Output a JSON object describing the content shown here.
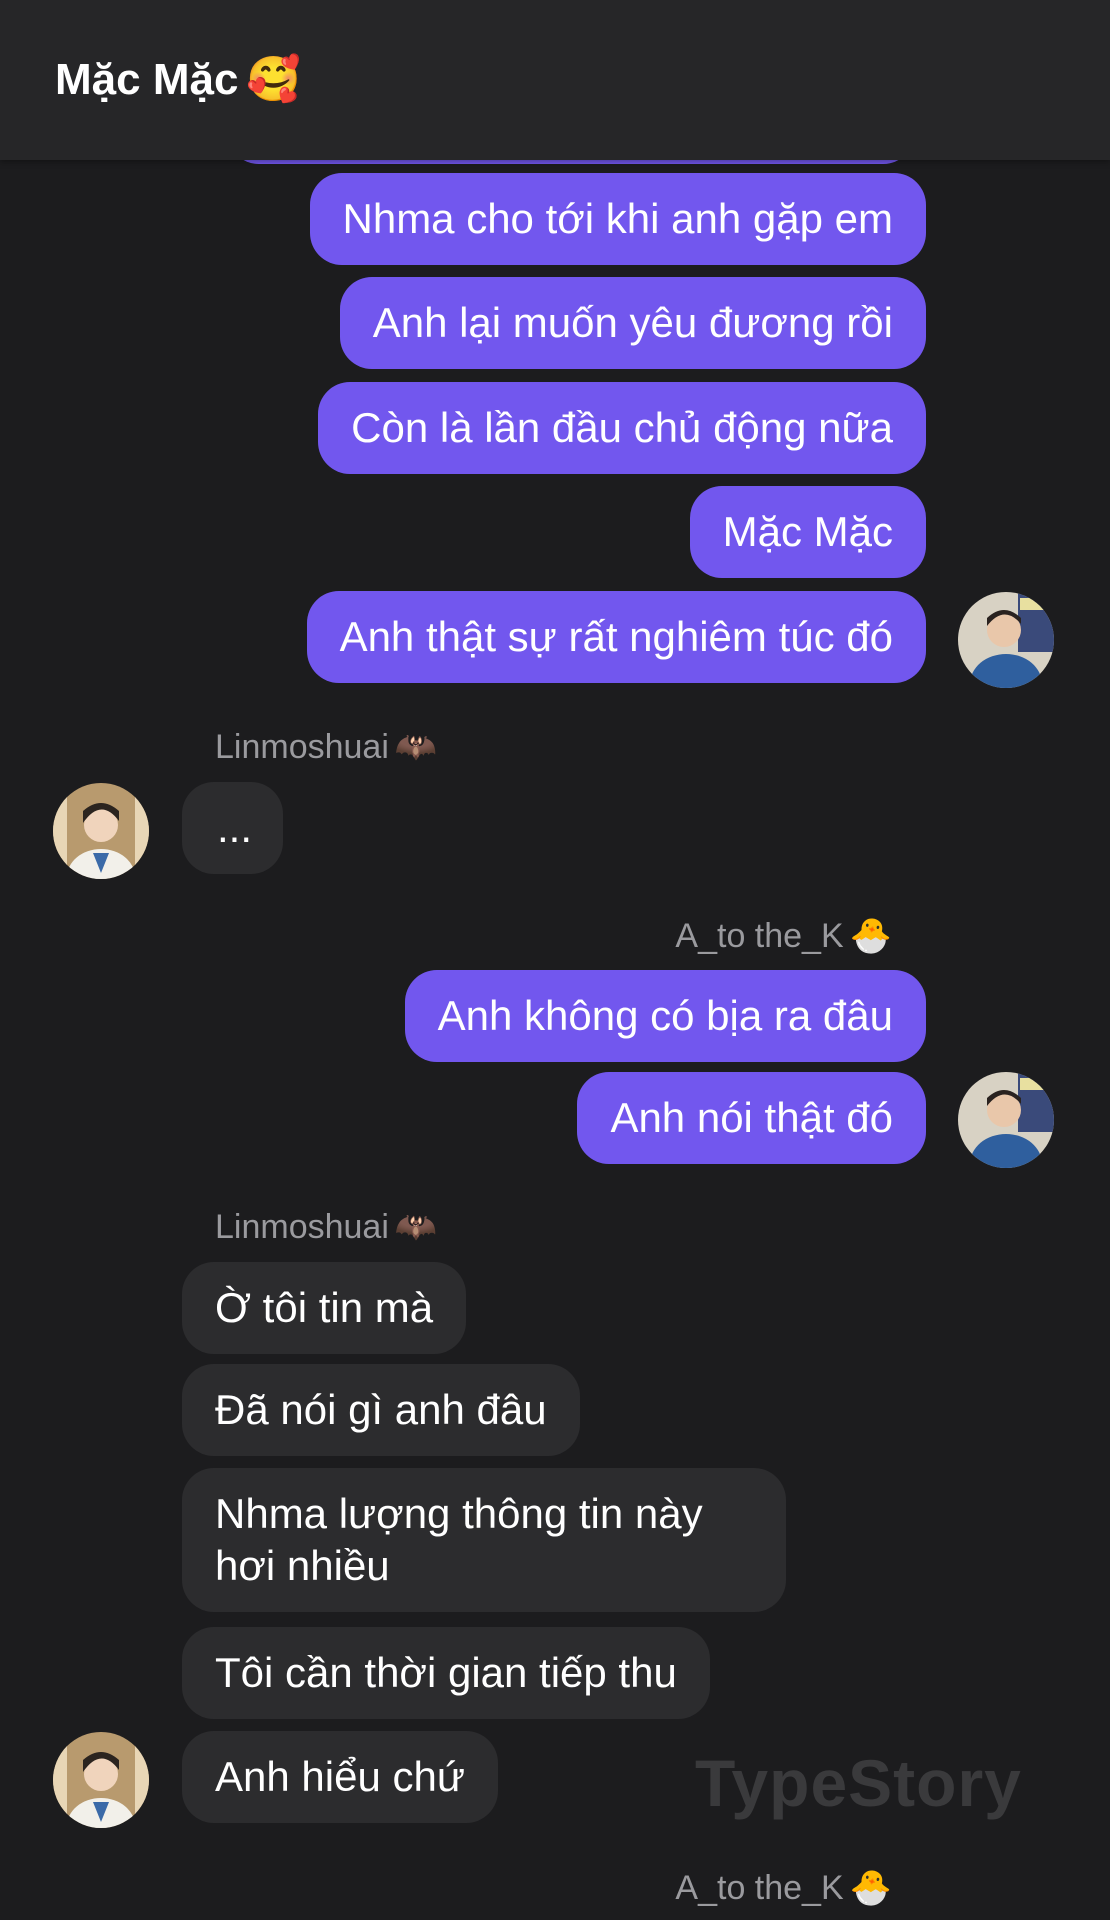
{
  "header": {
    "title": "Mặc Mặc",
    "title_emoji": "🥰"
  },
  "messages": [
    {
      "text": "Nhma cho tới khi anh gặp em"
    },
    {
      "text": "Anh lại muốn yêu đương rồi"
    },
    {
      "text": "Còn là lần đầu chủ động nữa"
    },
    {
      "text": "Mặc Mặc"
    },
    {
      "text": "Anh thật sự rất nghiêm túc đó"
    },
    {
      "text": "..."
    },
    {
      "text": "Anh không có bịa ra đâu"
    },
    {
      "text": "Anh nói thật đó"
    },
    {
      "text": "Ờ tôi tin mà"
    },
    {
      "text": "Đã nói gì anh đâu"
    },
    {
      "text": "Nhma lượng thông tin này hơi nhiều"
    },
    {
      "text": "Tôi cần thời gian tiếp thu"
    },
    {
      "text": "Anh hiểu chứ"
    }
  ],
  "senders": {
    "in": {
      "name": "Linmoshuai",
      "emoji": "🦇"
    },
    "out": {
      "name": "A_to the_K",
      "emoji": "🐣"
    }
  },
  "watermark": "TypeStory"
}
